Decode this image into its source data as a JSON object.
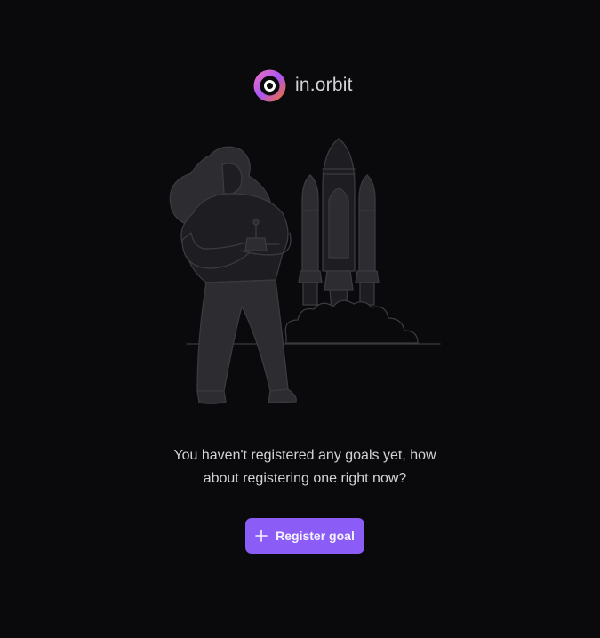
{
  "logo": {
    "text": "in.orbit",
    "icon": "orbit-logo-icon",
    "gradient_colors": [
      "#f472b6",
      "#a855f7",
      "#f97316"
    ]
  },
  "illustration": {
    "icon": "woman-launching-rocket-illustration"
  },
  "empty_state": {
    "message": "You haven't registered any goals yet, how about registering one right now?"
  },
  "register_button": {
    "label": "Register goal",
    "icon": "plus-icon",
    "color": "#8b5cf6"
  },
  "colors": {
    "background": "#0a0a0c",
    "text": "#d4d4d8"
  }
}
